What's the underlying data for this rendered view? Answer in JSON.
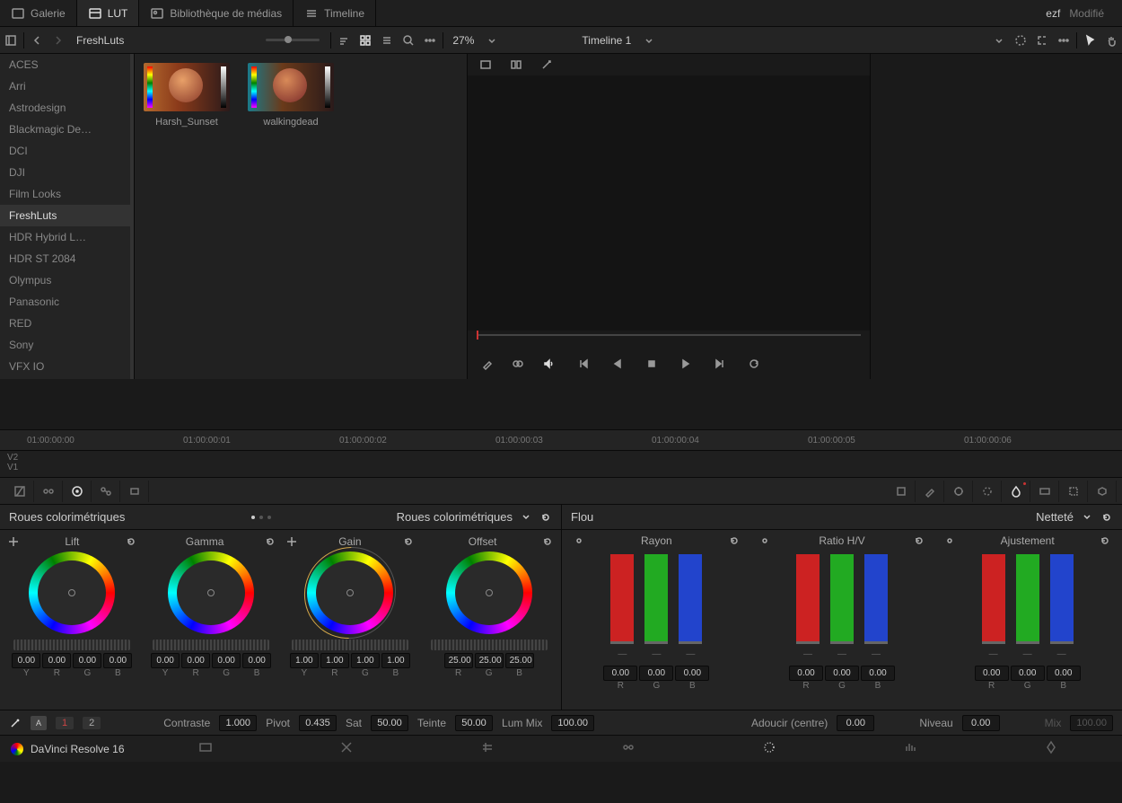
{
  "top_tabs": {
    "gallery": "Galerie",
    "lut": "LUT",
    "media": "Bibliothèque de médias",
    "timeline": "Timeline"
  },
  "project": {
    "name": "ezf",
    "status": "Modifié"
  },
  "toolbar": {
    "breadcrumb": "FreshLuts",
    "zoom": "27%",
    "timeline_name": "Timeline 1"
  },
  "sidebar": {
    "items": [
      "ACES",
      "Arri",
      "Astrodesign",
      "Blackmagic De…",
      "DCI",
      "DJI",
      "Film Looks",
      "FreshLuts",
      "HDR Hybrid L…",
      "HDR ST 2084",
      "Olympus",
      "Panasonic",
      "RED",
      "Sony",
      "VFX IO"
    ],
    "active": "FreshLuts"
  },
  "luts": [
    {
      "name": "Harsh_Sunset"
    },
    {
      "name": "walkingdead"
    }
  ],
  "timeline": {
    "tcs": [
      "01:00:00:00",
      "01:00:00:01",
      "01:00:00:02",
      "01:00:00:03",
      "01:00:00:04",
      "01:00:00:05",
      "01:00:00:06"
    ],
    "tracks": [
      "V2",
      "V1"
    ]
  },
  "wheels_panel": {
    "title": "Roues colorimétriques",
    "mode": "Roues colorimétriques"
  },
  "wheels": {
    "lift": {
      "label": "Lift",
      "vals": [
        "0.00",
        "0.00",
        "0.00",
        "0.00"
      ],
      "chans": [
        "Y",
        "R",
        "G",
        "B"
      ]
    },
    "gamma": {
      "label": "Gamma",
      "vals": [
        "0.00",
        "0.00",
        "0.00",
        "0.00"
      ],
      "chans": [
        "Y",
        "R",
        "G",
        "B"
      ]
    },
    "gain": {
      "label": "Gain",
      "vals": [
        "1.00",
        "1.00",
        "1.00",
        "1.00"
      ],
      "chans": [
        "Y",
        "R",
        "G",
        "B"
      ]
    },
    "offset": {
      "label": "Offset",
      "vals": [
        "25.00",
        "25.00",
        "25.00"
      ],
      "chans": [
        "R",
        "G",
        "B"
      ]
    }
  },
  "blur_panel": {
    "title": "Flou",
    "mode": "Netteté"
  },
  "bars": {
    "radius": {
      "label": "Rayon",
      "vals": [
        "0.00",
        "0.00",
        "0.00"
      ],
      "chans": [
        "R",
        "G",
        "B"
      ]
    },
    "ratio": {
      "label": "Ratio H/V",
      "vals": [
        "0.00",
        "0.00",
        "0.00"
      ],
      "chans": [
        "R",
        "G",
        "B"
      ]
    },
    "adjust": {
      "label": "Ajustement",
      "vals": [
        "0.00",
        "0.00",
        "0.00"
      ],
      "chans": [
        "R",
        "G",
        "B"
      ]
    }
  },
  "adjustments_left": {
    "node1": "1",
    "node2": "2",
    "contrast_l": "Contraste",
    "contrast_v": "1.000",
    "pivot_l": "Pivot",
    "pivot_v": "0.435",
    "sat_l": "Sat",
    "sat_v": "50.00",
    "hue_l": "Teinte",
    "hue_v": "50.00",
    "lummix_l": "Lum Mix",
    "lummix_v": "100.00"
  },
  "adjustments_right": {
    "soften_l": "Adoucir (centre)",
    "soften_v": "0.00",
    "level_l": "Niveau",
    "level_v": "0.00",
    "mix_l": "Mix",
    "mix_v": "100.00"
  },
  "app": {
    "name": "DaVinci Resolve 16"
  }
}
